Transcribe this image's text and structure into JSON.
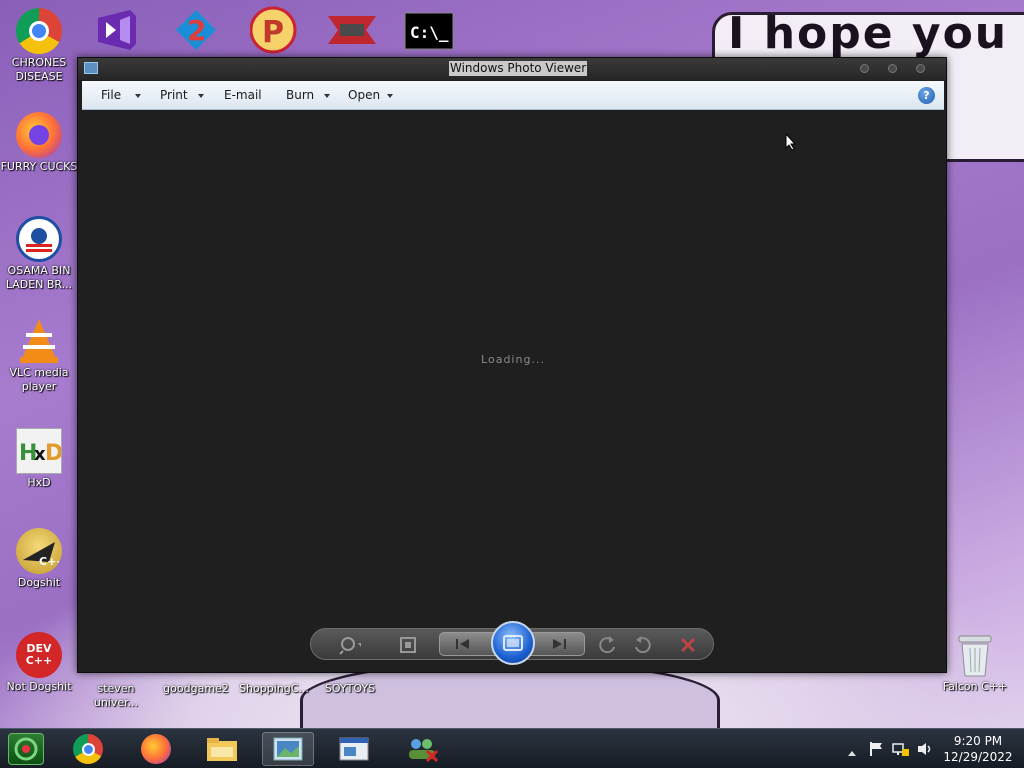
{
  "desktop": {
    "icons": [
      {
        "label": "CHRONES DISEASE"
      },
      {
        "label": "FURRY CUCKS"
      },
      {
        "label": "OSAMA BIN LADEN BR..."
      },
      {
        "label": "VLC media player"
      },
      {
        "label": "HxD"
      },
      {
        "label": "Dogshit"
      },
      {
        "label": "Not Dogshit"
      }
    ],
    "bottom_labels": [
      "steven univer...",
      "goodgame2",
      "ShoppingC...",
      "SOYTOYS",
      "Falcon C++"
    ],
    "wallpaper_text": "I hope you"
  },
  "window": {
    "title": "Windows Photo Viewer",
    "menu": {
      "file": "File",
      "print": "Print",
      "email": "E-mail",
      "burn": "Burn",
      "open": "Open"
    },
    "status": "Loading...",
    "help_icon_glyph": "?"
  },
  "taskbar": {
    "time": "9:20 PM",
    "date": "12/29/2022"
  },
  "colors": {
    "window_bg": "#1f1f1f",
    "toolbar_bg": "#e6eef6",
    "accent": "#1c5fd1"
  }
}
